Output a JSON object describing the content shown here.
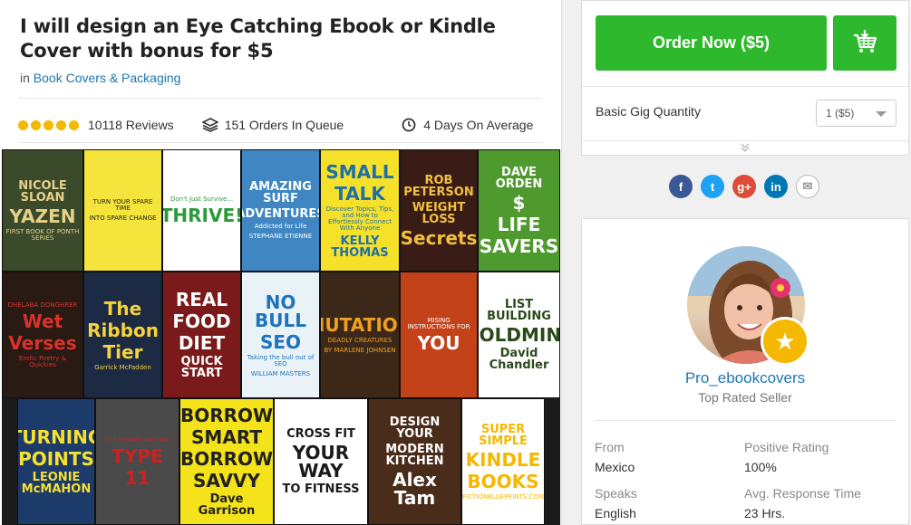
{
  "gig": {
    "title": "I will design an Eye Catching Ebook or Kindle Cover with bonus for $5",
    "category_prefix": "in",
    "category": "Book Covers & Packaging",
    "reviews": "10118 Reviews",
    "orders": "151 Orders In Queue",
    "delivery": "4 Days On Average",
    "rating_stars": 5
  },
  "gallery": {
    "books": [
      {
        "lines": [
          "NICOLE SLOAN",
          "YAZEN",
          "FIRST BOOK OF PONTH SERIES"
        ],
        "bg": "#3a4a2a",
        "fg": "#e6d08a"
      },
      {
        "lines": [
          "TURN YOUR SPARE TIME",
          "INTO SPARE CHANGE"
        ],
        "bg": "#f4e43b",
        "fg": "#222"
      },
      {
        "lines": [
          "Don't Just Survive...",
          "THRIVE!"
        ],
        "bg": "#ffffff",
        "fg": "#2a9a3a"
      },
      {
        "lines": [
          "AMAZING SURF",
          "ADVENTURES",
          "Addicted for Life",
          "STEPHANE ETIENNE"
        ],
        "bg": "#3f86c2",
        "fg": "#ffffff"
      },
      {
        "lines": [
          "SMALL",
          "TALK",
          "Discover Topics, Tips, and How to Effortlessly Connect With Anyone",
          "KELLY THOMAS"
        ],
        "bg": "#f5e12a",
        "fg": "#1f6fa8"
      },
      {
        "lines": [
          "ROB PETERSON",
          "WEIGHT LOSS",
          "Secrets"
        ],
        "bg": "#3a1c16",
        "fg": "#f0c040"
      },
      {
        "lines": [
          "DAVE ORDEN",
          "$",
          "LIFE",
          "SAVERS"
        ],
        "bg": "#4f9a2e",
        "fg": "#ffffff"
      },
      {
        "lines": [
          "DHELABA DONGHRER",
          "Wet",
          "Verses",
          "Erotic Poetry & Quickies"
        ],
        "bg": "#2a1a14",
        "fg": "#d9322a"
      },
      {
        "lines": [
          "The",
          "Ribbon",
          "Tier",
          "Garrick McFadden"
        ],
        "bg": "#1c2a44",
        "fg": "#f6d33a"
      },
      {
        "lines": [
          "REAL",
          "FOOD",
          "DIET",
          "QUICK START"
        ],
        "bg": "#7a1a1a",
        "fg": "#ffffff"
      },
      {
        "lines": [
          "NO BULL",
          "SEO",
          "Taking the bull out of SEO",
          "WILLIAM MASTERS"
        ],
        "bg": "#e9f3f7",
        "fg": "#1e73be"
      },
      {
        "lines": [
          "MUTATION",
          "DEADLY CREATURES",
          "BY MARLENE JOHNSEN"
        ],
        "bg": "#3b2818",
        "fg": "#f0a020"
      },
      {
        "lines": [
          "MISING INSTRUCTIONS FOR",
          "YOU"
        ],
        "bg": "#c4421a",
        "fg": "#ffffff"
      },
      {
        "lines": [
          "LIST BUILDING",
          "GOLDMINE",
          "David Chandler"
        ],
        "bg": "#ffffff",
        "fg": "#2a4a1a"
      },
      {
        "lines": [
          "TURNING",
          "POINTS",
          "LEONIE McMAHON"
        ],
        "bg": "#1c3a6a",
        "fg": "#f6e030"
      },
      {
        "lines": [
          "R. EDWARD McCAIN",
          "TYPE",
          "11"
        ],
        "bg": "#4a4a4a",
        "fg": "#d02020"
      },
      {
        "lines": [
          "BORROW",
          "SMART",
          "BORROW",
          "SAVVY",
          "Dave Garrison"
        ],
        "bg": "#f4e21a",
        "fg": "#222"
      },
      {
        "lines": [
          "CROSS FIT",
          "YOUR WAY",
          "TO FITNESS"
        ],
        "bg": "#ffffff",
        "fg": "#1a1a1a"
      },
      {
        "lines": [
          "DESIGN YOUR",
          "MODERN KITCHEN",
          "Alex Tam"
        ],
        "bg": "#4a2c1a",
        "fg": "#ffffff"
      },
      {
        "lines": [
          "SUPER SIMPLE",
          "KINDLE",
          "BOOKS",
          "FICTIONBLUEPRINTS.COM"
        ],
        "bg": "#ffffff",
        "fg": "#f5b800"
      }
    ]
  },
  "order": {
    "button_label": "Order Now ($5)",
    "quantity_label": "Basic Gig Quantity",
    "quantity_value": "1 ($5)"
  },
  "social": [
    {
      "name": "facebook",
      "glyph": "f",
      "color": "#3b5998"
    },
    {
      "name": "twitter",
      "glyph": "t",
      "color": "#1da1f2"
    },
    {
      "name": "google-plus",
      "glyph": "g+",
      "color": "#dd4b39"
    },
    {
      "name": "linkedin",
      "glyph": "in",
      "color": "#0077b5"
    },
    {
      "name": "email",
      "glyph": "✉",
      "color": "#ffffff"
    }
  ],
  "seller": {
    "name": "Pro_ebookcovers",
    "level": "Top Rated Seller",
    "from_label": "From",
    "from_value": "Mexico",
    "rating_label": "Positive Rating",
    "rating_value": "100%",
    "speaks_label": "Speaks",
    "speaks_value": "English",
    "response_label": "Avg. Response Time",
    "response_value": "23 Hrs."
  },
  "colors": {
    "accent_green": "#2eb82e",
    "link_blue": "#1d76b5",
    "star_yellow": "#f5b800"
  }
}
